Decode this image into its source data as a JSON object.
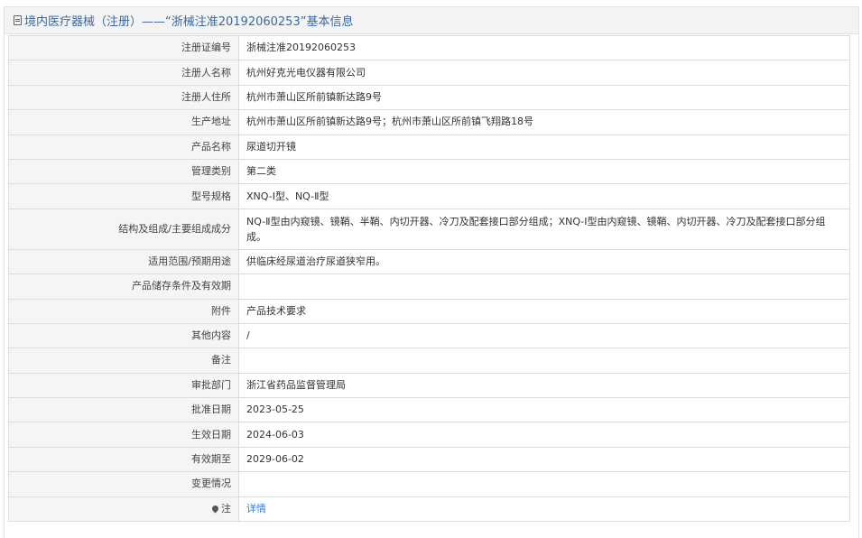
{
  "header": {
    "title": "境内医疗器械（注册）——“浙械注准20192060253”基本信息"
  },
  "rows": [
    {
      "label": "注册证编号",
      "value": "浙械注准20192060253"
    },
    {
      "label": "注册人名称",
      "value": "杭州好克光电仪器有限公司"
    },
    {
      "label": "注册人住所",
      "value": "杭州市萧山区所前镇新达路9号"
    },
    {
      "label": "生产地址",
      "value": "杭州市萧山区所前镇新达路9号；杭州市萧山区所前镇飞翔路18号"
    },
    {
      "label": "产品名称",
      "value": "尿道切开镜"
    },
    {
      "label": "管理类别",
      "value": "第二类"
    },
    {
      "label": "型号规格",
      "value": "XNQ-Ⅰ型、NQ-Ⅱ型"
    },
    {
      "label": "结构及组成/主要组成成分",
      "value": "NQ-Ⅱ型由内窥镜、镜鞘、半鞘、内切开器、冷刀及配套接口部分组成；XNQ-Ⅰ型由内窥镜、镜鞘、内切开器、冷刀及配套接口部分组成。"
    },
    {
      "label": "适用范围/预期用途",
      "value": "供临床经尿道治疗尿道狭窄用。"
    },
    {
      "label": "产品储存条件及有效期",
      "value": ""
    },
    {
      "label": "附件",
      "value": "产品技术要求"
    },
    {
      "label": "其他内容",
      "value": "/"
    },
    {
      "label": "备注",
      "value": ""
    },
    {
      "label": "审批部门",
      "value": "浙江省药品监督管理局"
    },
    {
      "label": "批准日期",
      "value": "2023-05-25"
    },
    {
      "label": "生效日期",
      "value": "2024-06-03"
    },
    {
      "label": "有效期至",
      "value": "2029-06-02"
    },
    {
      "label": "变更情况",
      "value": ""
    }
  ],
  "note": {
    "label": "注",
    "icon": "pin-icon",
    "link_text": "详情"
  }
}
